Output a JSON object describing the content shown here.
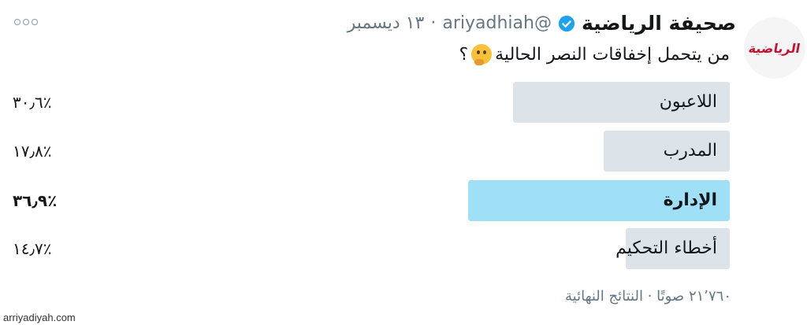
{
  "tweet": {
    "display_name": "صحيفة الرياضية",
    "handle": "@ariyadhiah",
    "separator": "·",
    "date": "١٣ ديسمبر",
    "text": "من يتحمل إخفاقات النصر الحالية",
    "question_mark": "؟",
    "avatar_logo": "الرياضية",
    "icons": {
      "verified": "verified-badge-icon",
      "more": "more-options-icon",
      "emoji": "thinking-face-emoji"
    },
    "colors": {
      "verified": "#1da1f2",
      "poll_bar": "#dde4e9",
      "poll_bar_winner": "#9fe0f6",
      "avatar_logo": "#c8102e"
    }
  },
  "poll": {
    "options": [
      {
        "label": "اللاعبون",
        "percent_text": "٣٠٫٦٪",
        "percent": 30.6,
        "winner": false
      },
      {
        "label": "المدرب",
        "percent_text": "١٧٫٨٪",
        "percent": 17.8,
        "winner": false
      },
      {
        "label": "الإدارة",
        "percent_text": "٣٦٫٩٪",
        "percent": 36.9,
        "winner": true
      },
      {
        "label": "أخطاء التحكيم",
        "percent_text": "١٤٫٧٪",
        "percent": 14.7,
        "winner": false
      }
    ],
    "footer": "٢١٬٧٦٠ صوتًا · النتائج النهائية"
  },
  "watermark": "arriyadiyah.com"
}
